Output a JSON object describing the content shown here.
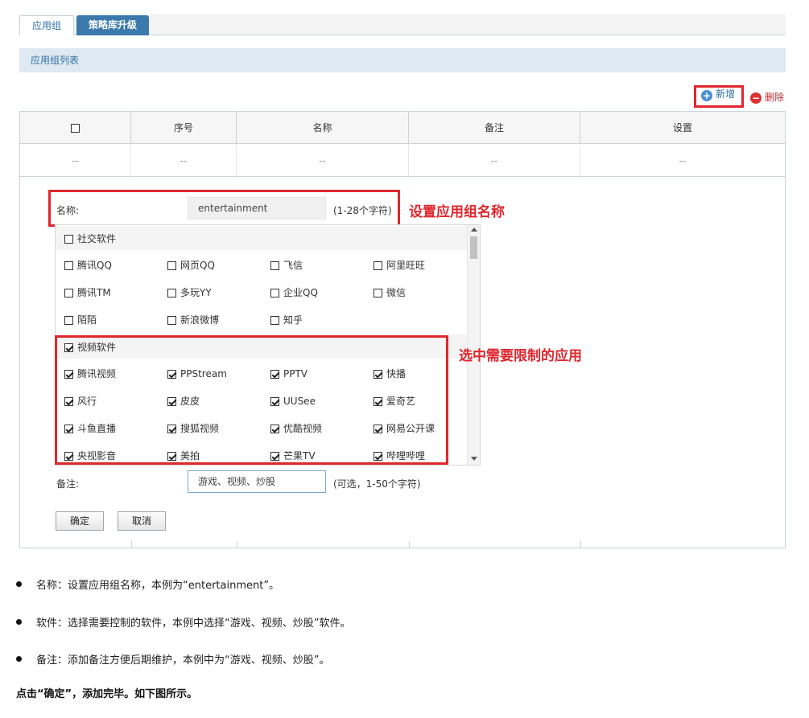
{
  "tabs": [
    {
      "label": "应用组"
    },
    {
      "label": "策略库升级"
    }
  ],
  "section_title": "应用组列表",
  "toolbar": {
    "add_label": "新增",
    "delete_label": "删除"
  },
  "table": {
    "headers": [
      "序号",
      "名称",
      "备注",
      "设置"
    ],
    "empty_cell": "--"
  },
  "form": {
    "name_label": "名称:",
    "name_value": "entertainment",
    "name_hint": "(1-28个字符)",
    "remark_label": "备注:",
    "remark_value": "游戏、视频、炒股",
    "remark_hint": "(可选，1-50个字符)",
    "confirm_label": "确定",
    "cancel_label": "取消"
  },
  "categories": [
    {
      "name": "社交软件",
      "checked": false,
      "apps": [
        "腾讯QQ",
        "网页QQ",
        "飞信",
        "阿里旺旺",
        "腾讯TM",
        "多玩YY",
        "企业QQ",
        "微信",
        "陌陌",
        "新浪微博",
        "知乎"
      ]
    },
    {
      "name": "视频软件",
      "checked": true,
      "apps": [
        "腾讯视频",
        "PPStream",
        "PPTV",
        "快播",
        "风行",
        "皮皮",
        "UUSee",
        "爱奇艺",
        "斗鱼直播",
        "搜狐视频",
        "优酷视频",
        "网易公开课",
        "央视影音",
        "美拍",
        "芒果TV",
        "哔哩哔哩"
      ]
    }
  ],
  "annotations": {
    "name": "设置应用组名称",
    "apps": "选中需要限制的应用"
  },
  "bullets": [
    "名称：设置应用组名称，本例为“entertainment”。",
    "软件：选择需要控制的软件，本例中选择“游戏、视频、炒股”软件。",
    "备注：添加备注方便后期维护，本例中为“游戏、视频、炒股”。"
  ],
  "final_note": "点击“确定”，添加完毕。如下图所示。",
  "colors": {
    "accent": "#3b79ad",
    "highlight": "#e0262e",
    "header_bg": "#dfe9f2"
  }
}
